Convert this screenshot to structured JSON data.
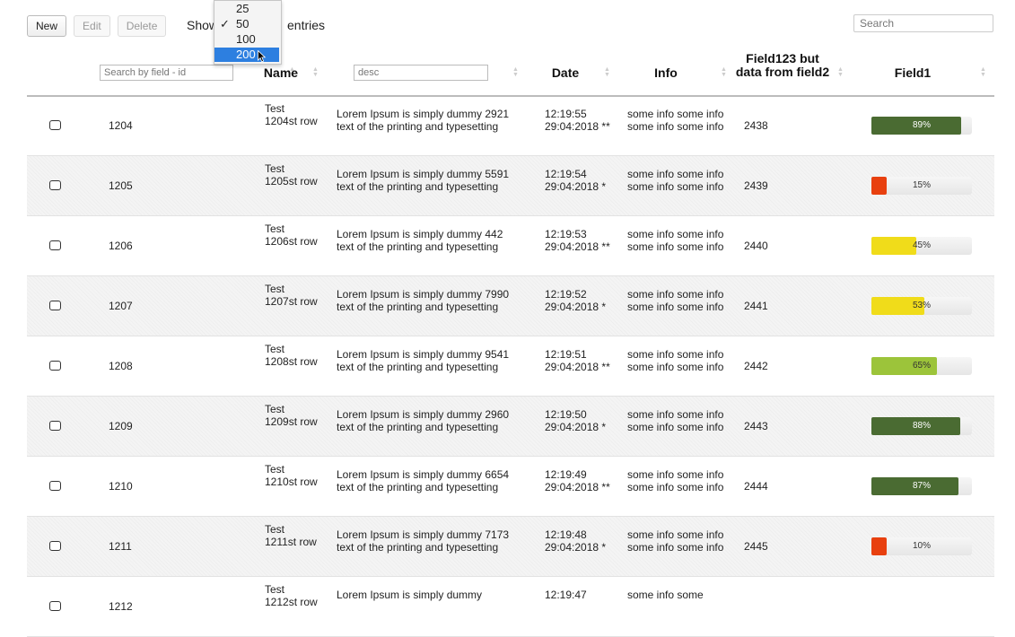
{
  "toolbar": {
    "new_label": "New",
    "edit_label": "Edit",
    "delete_label": "Delete",
    "show_label": "Show",
    "entries_label": "entries"
  },
  "page_length": {
    "options": [
      "25",
      "50",
      "100",
      "200"
    ],
    "checked": "50",
    "highlighted": "200"
  },
  "search": {
    "placeholder": "Search"
  },
  "columns": {
    "id_filter_placeholder": "Search by field - id",
    "name": "Name",
    "desc_filter_placeholder": "desc",
    "date": "Date",
    "info": "Info",
    "field2": "Field123 but data from field2",
    "field1": "Field1"
  },
  "colors": {
    "bar_dark_green": "#4a6b32",
    "bar_light_green": "#9cc43a",
    "bar_yellow": "#f0dc1a",
    "bar_red": "#e8400f",
    "highlight": "#2d7fe0"
  },
  "rows": [
    {
      "id": "1204",
      "name": "Test 1204st row",
      "desc": "Lorem Ipsum is simply dummy 2921 text of the printing and typesetting",
      "date": "12:19:55 29:04:2018 **",
      "info": "some info some info some info some info",
      "field2": "2438",
      "progress": 89,
      "progress_label": "89%"
    },
    {
      "id": "1205",
      "name": "Test 1205st row",
      "desc": "Lorem Ipsum is simply dummy 5591 text of the printing and typesetting",
      "date": "12:19:54 29:04:2018 *",
      "info": "some info some info some info some info",
      "field2": "2439",
      "progress": 15,
      "progress_label": "15%"
    },
    {
      "id": "1206",
      "name": "Test 1206st row",
      "desc": "Lorem Ipsum is simply dummy 442 text of the printing and typesetting",
      "date": "12:19:53 29:04:2018 **",
      "info": "some info some info some info some info",
      "field2": "2440",
      "progress": 45,
      "progress_label": "45%"
    },
    {
      "id": "1207",
      "name": "Test 1207st row",
      "desc": "Lorem Ipsum is simply dummy 7990 text of the printing and typesetting",
      "date": "12:19:52 29:04:2018 *",
      "info": "some info some info some info some info",
      "field2": "2441",
      "progress": 53,
      "progress_label": "53%"
    },
    {
      "id": "1208",
      "name": "Test 1208st row",
      "desc": "Lorem Ipsum is simply dummy 9541 text of the printing and typesetting",
      "date": "12:19:51 29:04:2018 **",
      "info": "some info some info some info some info",
      "field2": "2442",
      "progress": 65,
      "progress_label": "65%"
    },
    {
      "id": "1209",
      "name": "Test 1209st row",
      "desc": "Lorem Ipsum is simply dummy 2960 text of the printing and typesetting",
      "date": "12:19:50 29:04:2018 *",
      "info": "some info some info some info some info",
      "field2": "2443",
      "progress": 88,
      "progress_label": "88%"
    },
    {
      "id": "1210",
      "name": "Test 1210st row",
      "desc": "Lorem Ipsum is simply dummy 6654 text of the printing and typesetting",
      "date": "12:19:49 29:04:2018 **",
      "info": "some info some info some info some info",
      "field2": "2444",
      "progress": 87,
      "progress_label": "87%"
    },
    {
      "id": "1211",
      "name": "Test 1211st row",
      "desc": "Lorem Ipsum is simply dummy 7173 text of the printing and typesetting",
      "date": "12:19:48 29:04:2018 *",
      "info": "some info some info some info some info",
      "field2": "2445",
      "progress": 10,
      "progress_label": "10%"
    },
    {
      "id": "1212",
      "name": "Test 1212st row",
      "desc": "Lorem Ipsum is simply dummy",
      "date": "12:19:47",
      "info": "some info some",
      "field2": "",
      "progress": 0,
      "progress_label": ""
    }
  ]
}
